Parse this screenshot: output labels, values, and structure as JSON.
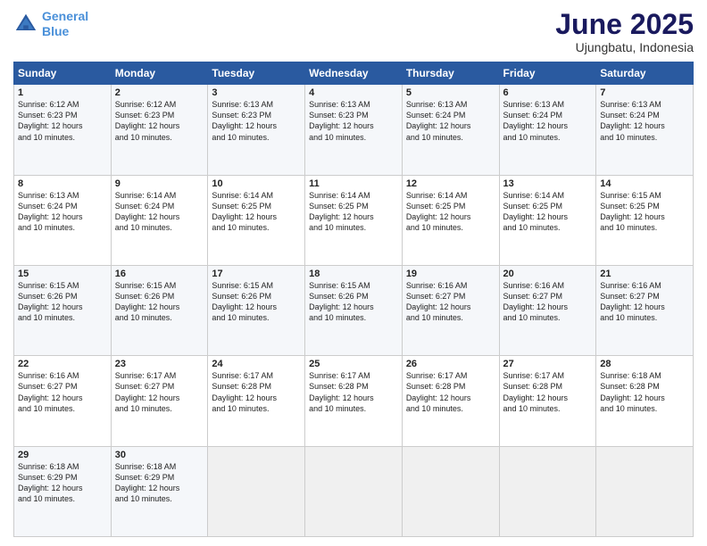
{
  "header": {
    "logo_line1": "General",
    "logo_line2": "Blue",
    "title": "June 2025",
    "subtitle": "Ujungbatu, Indonesia"
  },
  "days_of_week": [
    "Sunday",
    "Monday",
    "Tuesday",
    "Wednesday",
    "Thursday",
    "Friday",
    "Saturday"
  ],
  "weeks": [
    [
      {
        "day": "1",
        "lines": [
          "Sunrise: 6:12 AM",
          "Sunset: 6:23 PM",
          "Daylight: 12 hours",
          "and 10 minutes."
        ]
      },
      {
        "day": "2",
        "lines": [
          "Sunrise: 6:12 AM",
          "Sunset: 6:23 PM",
          "Daylight: 12 hours",
          "and 10 minutes."
        ]
      },
      {
        "day": "3",
        "lines": [
          "Sunrise: 6:13 AM",
          "Sunset: 6:23 PM",
          "Daylight: 12 hours",
          "and 10 minutes."
        ]
      },
      {
        "day": "4",
        "lines": [
          "Sunrise: 6:13 AM",
          "Sunset: 6:23 PM",
          "Daylight: 12 hours",
          "and 10 minutes."
        ]
      },
      {
        "day": "5",
        "lines": [
          "Sunrise: 6:13 AM",
          "Sunset: 6:24 PM",
          "Daylight: 12 hours",
          "and 10 minutes."
        ]
      },
      {
        "day": "6",
        "lines": [
          "Sunrise: 6:13 AM",
          "Sunset: 6:24 PM",
          "Daylight: 12 hours",
          "and 10 minutes."
        ]
      },
      {
        "day": "7",
        "lines": [
          "Sunrise: 6:13 AM",
          "Sunset: 6:24 PM",
          "Daylight: 12 hours",
          "and 10 minutes."
        ]
      }
    ],
    [
      {
        "day": "8",
        "lines": [
          "Sunrise: 6:13 AM",
          "Sunset: 6:24 PM",
          "Daylight: 12 hours",
          "and 10 minutes."
        ]
      },
      {
        "day": "9",
        "lines": [
          "Sunrise: 6:14 AM",
          "Sunset: 6:24 PM",
          "Daylight: 12 hours",
          "and 10 minutes."
        ]
      },
      {
        "day": "10",
        "lines": [
          "Sunrise: 6:14 AM",
          "Sunset: 6:25 PM",
          "Daylight: 12 hours",
          "and 10 minutes."
        ]
      },
      {
        "day": "11",
        "lines": [
          "Sunrise: 6:14 AM",
          "Sunset: 6:25 PM",
          "Daylight: 12 hours",
          "and 10 minutes."
        ]
      },
      {
        "day": "12",
        "lines": [
          "Sunrise: 6:14 AM",
          "Sunset: 6:25 PM",
          "Daylight: 12 hours",
          "and 10 minutes."
        ]
      },
      {
        "day": "13",
        "lines": [
          "Sunrise: 6:14 AM",
          "Sunset: 6:25 PM",
          "Daylight: 12 hours",
          "and 10 minutes."
        ]
      },
      {
        "day": "14",
        "lines": [
          "Sunrise: 6:15 AM",
          "Sunset: 6:25 PM",
          "Daylight: 12 hours",
          "and 10 minutes."
        ]
      }
    ],
    [
      {
        "day": "15",
        "lines": [
          "Sunrise: 6:15 AM",
          "Sunset: 6:26 PM",
          "Daylight: 12 hours",
          "and 10 minutes."
        ]
      },
      {
        "day": "16",
        "lines": [
          "Sunrise: 6:15 AM",
          "Sunset: 6:26 PM",
          "Daylight: 12 hours",
          "and 10 minutes."
        ]
      },
      {
        "day": "17",
        "lines": [
          "Sunrise: 6:15 AM",
          "Sunset: 6:26 PM",
          "Daylight: 12 hours",
          "and 10 minutes."
        ]
      },
      {
        "day": "18",
        "lines": [
          "Sunrise: 6:15 AM",
          "Sunset: 6:26 PM",
          "Daylight: 12 hours",
          "and 10 minutes."
        ]
      },
      {
        "day": "19",
        "lines": [
          "Sunrise: 6:16 AM",
          "Sunset: 6:27 PM",
          "Daylight: 12 hours",
          "and 10 minutes."
        ]
      },
      {
        "day": "20",
        "lines": [
          "Sunrise: 6:16 AM",
          "Sunset: 6:27 PM",
          "Daylight: 12 hours",
          "and 10 minutes."
        ]
      },
      {
        "day": "21",
        "lines": [
          "Sunrise: 6:16 AM",
          "Sunset: 6:27 PM",
          "Daylight: 12 hours",
          "and 10 minutes."
        ]
      }
    ],
    [
      {
        "day": "22",
        "lines": [
          "Sunrise: 6:16 AM",
          "Sunset: 6:27 PM",
          "Daylight: 12 hours",
          "and 10 minutes."
        ]
      },
      {
        "day": "23",
        "lines": [
          "Sunrise: 6:17 AM",
          "Sunset: 6:27 PM",
          "Daylight: 12 hours",
          "and 10 minutes."
        ]
      },
      {
        "day": "24",
        "lines": [
          "Sunrise: 6:17 AM",
          "Sunset: 6:28 PM",
          "Daylight: 12 hours",
          "and 10 minutes."
        ]
      },
      {
        "day": "25",
        "lines": [
          "Sunrise: 6:17 AM",
          "Sunset: 6:28 PM",
          "Daylight: 12 hours",
          "and 10 minutes."
        ]
      },
      {
        "day": "26",
        "lines": [
          "Sunrise: 6:17 AM",
          "Sunset: 6:28 PM",
          "Daylight: 12 hours",
          "and 10 minutes."
        ]
      },
      {
        "day": "27",
        "lines": [
          "Sunrise: 6:17 AM",
          "Sunset: 6:28 PM",
          "Daylight: 12 hours",
          "and 10 minutes."
        ]
      },
      {
        "day": "28",
        "lines": [
          "Sunrise: 6:18 AM",
          "Sunset: 6:28 PM",
          "Daylight: 12 hours",
          "and 10 minutes."
        ]
      }
    ],
    [
      {
        "day": "29",
        "lines": [
          "Sunrise: 6:18 AM",
          "Sunset: 6:29 PM",
          "Daylight: 12 hours",
          "and 10 minutes."
        ]
      },
      {
        "day": "30",
        "lines": [
          "Sunrise: 6:18 AM",
          "Sunset: 6:29 PM",
          "Daylight: 12 hours",
          "and 10 minutes."
        ]
      },
      {
        "day": "",
        "lines": []
      },
      {
        "day": "",
        "lines": []
      },
      {
        "day": "",
        "lines": []
      },
      {
        "day": "",
        "lines": []
      },
      {
        "day": "",
        "lines": []
      }
    ]
  ]
}
